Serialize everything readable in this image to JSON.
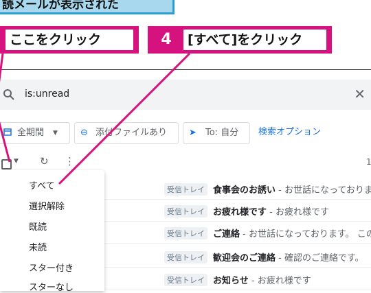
{
  "banner": {
    "text": "読メールが表示された"
  },
  "callouts": [
    {
      "number": "",
      "text": "ここをクリック"
    },
    {
      "number": "4",
      "text": "[すべて]をクリック"
    }
  ],
  "search": {
    "query": "is:unread",
    "clear_icon": "close-icon",
    "icon": "search-icon"
  },
  "filters": {
    "period": "全期間",
    "attachment": "添付ファイルあり",
    "to": "To: 自分",
    "advanced": "検索オプション"
  },
  "toolbar": {
    "page_count": "1"
  },
  "select_menu": {
    "items": [
      "すべて",
      "選択解除",
      "既読",
      "未読",
      "スター付き",
      "スターなし"
    ]
  },
  "emails": [
    {
      "label": "受信トレイ",
      "subject": "食事会のお誘い",
      "snippet": " - お世話になっておりま"
    },
    {
      "label": "受信トレイ",
      "subject": "お疲れ様です",
      "snippet": " - お疲れ様です"
    },
    {
      "label": "受信トレイ",
      "subject": "ご連絡",
      "snippet": " - お世話になっております。 この"
    },
    {
      "label": "受信トレイ",
      "subject": "歓迎会のご連絡",
      "snippet": " - 確認のご連絡です。"
    },
    {
      "label": "受信トレイ",
      "subject": "お知らせ",
      "snippet": " - お疲れ様です"
    }
  ],
  "colors": {
    "accent": "#d6127f",
    "banner_bg": "#a8d8ee",
    "banner_border": "#2a9fd6",
    "link": "#1a73e8"
  }
}
